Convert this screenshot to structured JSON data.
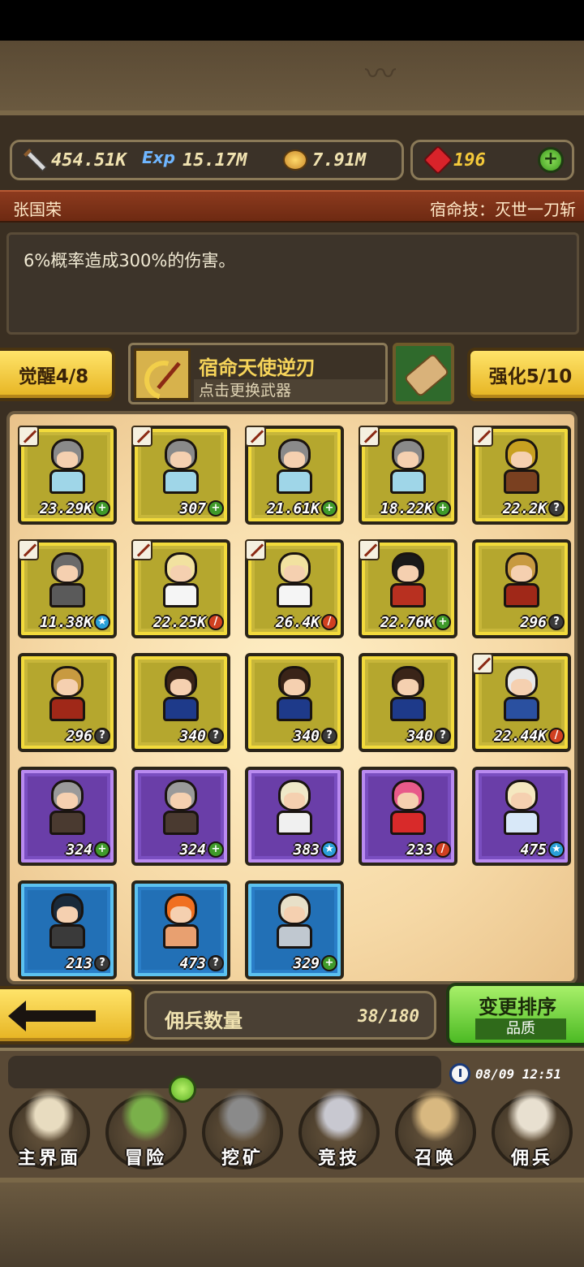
{
  "currencies": {
    "attack": {
      "icon": "sword-icon",
      "value": "454.51K"
    },
    "exp": {
      "icon": "exp-icon",
      "label": "Exp",
      "value": "15.17M"
    },
    "gold": {
      "icon": "coin-icon",
      "value": "7.91M"
    },
    "gems": {
      "icon": "gem-icon",
      "value": "196",
      "color": "#f4c93a"
    }
  },
  "hero": {
    "name": "张国荣",
    "skill": "宿命技：灭世一刀斩",
    "description": "6%概率造成300%的伤害。"
  },
  "actions": {
    "awaken": "觉醒4/8",
    "enhance": "强化5/10",
    "weapon_name": "宿命天使逆刃",
    "weapon_hint": "点击更换武器"
  },
  "cards": [
    {
      "rarity": "gold",
      "sword": true,
      "level": "23.29K",
      "status": "plus",
      "hair": "#8a8a8a",
      "outfit": "#9fd6e8"
    },
    {
      "rarity": "gold",
      "sword": true,
      "level": "307",
      "status": "plus",
      "hair": "#8a8a8a",
      "outfit": "#9fd6e8"
    },
    {
      "rarity": "gold",
      "sword": true,
      "level": "21.61K",
      "status": "plus",
      "hair": "#8a8a8a",
      "outfit": "#9fd6e8"
    },
    {
      "rarity": "gold",
      "sword": true,
      "level": "18.22K",
      "status": "plus",
      "hair": "#8a8a8a",
      "outfit": "#9fd6e8"
    },
    {
      "rarity": "gold",
      "sword": true,
      "level": "22.2K",
      "status": "q",
      "hair": "#c8a020",
      "outfit": "#7a4020"
    },
    {
      "rarity": "gold",
      "sword": true,
      "level": "11.38K",
      "status": "star",
      "hair": "#6a6a6a",
      "outfit": "#5a5a5a"
    },
    {
      "rarity": "gold",
      "sword": true,
      "level": "22.25K",
      "status": "dash",
      "hair": "#f2e2a0",
      "outfit": "#f5f5f5"
    },
    {
      "rarity": "gold",
      "sword": true,
      "level": "26.4K",
      "status": "dash",
      "hair": "#f2e2a0",
      "outfit": "#f5f5f5"
    },
    {
      "rarity": "gold",
      "sword": true,
      "level": "22.76K",
      "status": "plus",
      "hair": "#1a1a1a",
      "outfit": "#b83020"
    },
    {
      "rarity": "gold",
      "sword": false,
      "level": "296",
      "status": "q",
      "hair": "#c89a40",
      "outfit": "#a02818"
    },
    {
      "rarity": "gold",
      "sword": false,
      "level": "296",
      "status": "q",
      "hair": "#c89a40",
      "outfit": "#a02818"
    },
    {
      "rarity": "gold",
      "sword": false,
      "level": "340",
      "status": "q",
      "hair": "#3a2418",
      "outfit": "#1e3a8a"
    },
    {
      "rarity": "gold",
      "sword": false,
      "level": "340",
      "status": "q",
      "hair": "#3a2418",
      "outfit": "#1e3a8a"
    },
    {
      "rarity": "gold",
      "sword": false,
      "level": "340",
      "status": "q",
      "hair": "#3a2418",
      "outfit": "#1e3a8a"
    },
    {
      "rarity": "gold",
      "sword": true,
      "level": "22.44K",
      "status": "dash",
      "hair": "#e8e8e8",
      "outfit": "#2a50a0"
    },
    {
      "rarity": "purple",
      "sword": false,
      "level": "324",
      "status": "plus",
      "hair": "#9a9a9a",
      "outfit": "#4a3a30"
    },
    {
      "rarity": "purple",
      "sword": false,
      "level": "324",
      "status": "plus",
      "hair": "#9a9a9a",
      "outfit": "#4a3a30"
    },
    {
      "rarity": "purple",
      "sword": false,
      "level": "383",
      "status": "star",
      "hair": "#efe8c8",
      "outfit": "#f0f0f0"
    },
    {
      "rarity": "purple",
      "sword": false,
      "level": "233",
      "status": "dash",
      "hair": "#e85a8a",
      "outfit": "#d82a2a"
    },
    {
      "rarity": "purple",
      "sword": false,
      "level": "475",
      "status": "star",
      "hair": "#f5e8c0",
      "outfit": "#d8e8f8"
    },
    {
      "rarity": "blue",
      "sword": false,
      "level": "213",
      "status": "q",
      "hair": "#1a2a3a",
      "outfit": "#3a3a3a"
    },
    {
      "rarity": "blue",
      "sword": false,
      "level": "473",
      "status": "q",
      "hair": "#f07020",
      "outfit": "#e8a070"
    },
    {
      "rarity": "blue",
      "sword": false,
      "level": "329",
      "status": "plus",
      "hair": "#e8e0c8",
      "outfit": "#c0c8d0"
    }
  ],
  "bottom": {
    "count_label": "佣兵数量",
    "count_value": "38/180",
    "sort_label": "变更排序",
    "sort_mode": "品质",
    "time": "08/09 12:51"
  },
  "nav": [
    {
      "label": "主界面",
      "icon": "map-scroll-icon"
    },
    {
      "label": "冒险",
      "icon": "island-icon"
    },
    {
      "label": "挖矿",
      "icon": "pickaxe-icon"
    },
    {
      "label": "竞技",
      "icon": "crossed-swords-icon"
    },
    {
      "label": "召唤",
      "icon": "summon-scroll-icon"
    },
    {
      "label": "佣兵",
      "icon": "tent-icon"
    }
  ]
}
